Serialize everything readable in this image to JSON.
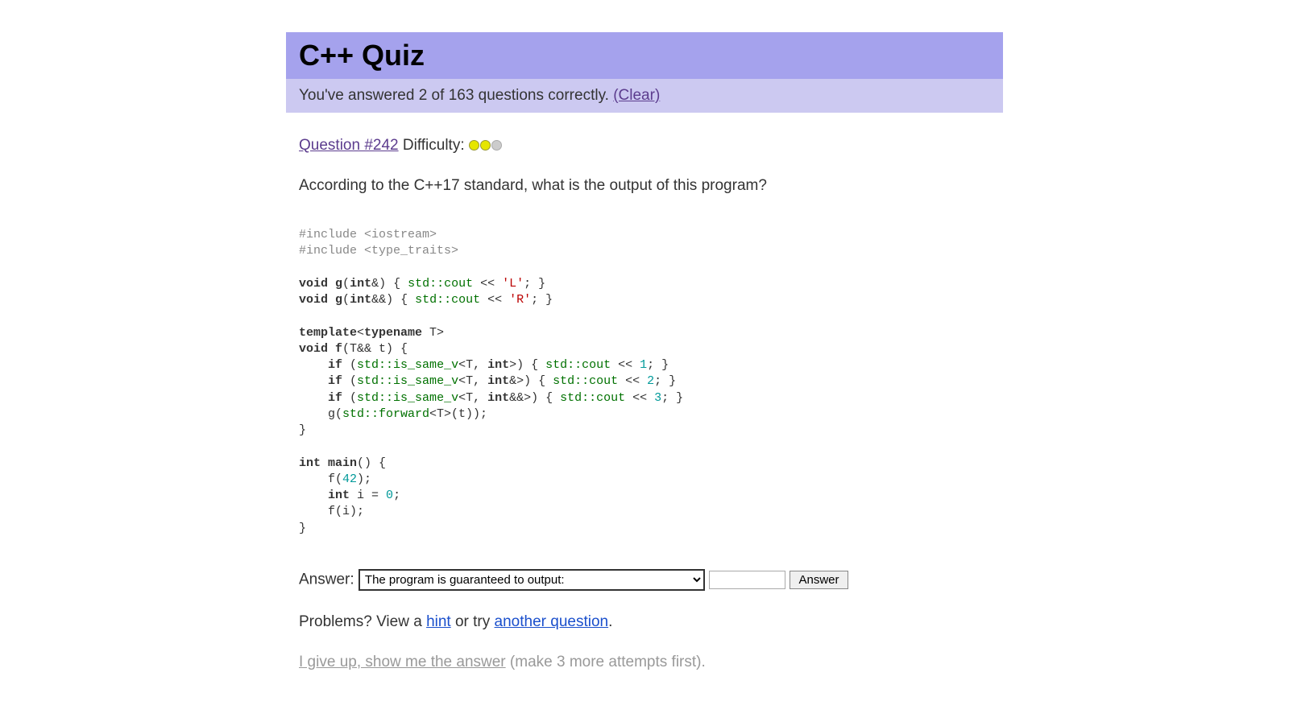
{
  "header": {
    "title": "C++ Quiz"
  },
  "progress": {
    "text_prefix": "You've answered ",
    "correct": "2",
    "text_middle": " of ",
    "total": "163",
    "text_suffix": " questions correctly. ",
    "clear_label": "(Clear)"
  },
  "question": {
    "link_label": "Question #242",
    "difficulty_label": " Difficulty: ",
    "difficulty_filled": 2,
    "difficulty_total": 3,
    "prompt": "According to the C++17 standard, what is the output of this program?"
  },
  "code": {
    "lines": [
      [
        {
          "t": "comment",
          "v": "#include <iostream>"
        }
      ],
      [
        {
          "t": "comment",
          "v": "#include <type_traits>"
        }
      ],
      [
        {
          "t": "plain",
          "v": ""
        }
      ],
      [
        {
          "t": "keyword",
          "v": "void"
        },
        {
          "t": "plain",
          "v": " "
        },
        {
          "t": "keyword",
          "v": "g"
        },
        {
          "t": "plain",
          "v": "("
        },
        {
          "t": "keyword",
          "v": "int"
        },
        {
          "t": "plain",
          "v": "&) { "
        },
        {
          "t": "stdcall",
          "v": "std::cout"
        },
        {
          "t": "plain",
          "v": " << "
        },
        {
          "t": "string",
          "v": "'L'"
        },
        {
          "t": "plain",
          "v": "; }"
        }
      ],
      [
        {
          "t": "keyword",
          "v": "void"
        },
        {
          "t": "plain",
          "v": " "
        },
        {
          "t": "keyword",
          "v": "g"
        },
        {
          "t": "plain",
          "v": "("
        },
        {
          "t": "keyword",
          "v": "int"
        },
        {
          "t": "plain",
          "v": "&&) { "
        },
        {
          "t": "stdcall",
          "v": "std::cout"
        },
        {
          "t": "plain",
          "v": " << "
        },
        {
          "t": "string",
          "v": "'R'"
        },
        {
          "t": "plain",
          "v": "; }"
        }
      ],
      [
        {
          "t": "plain",
          "v": ""
        }
      ],
      [
        {
          "t": "keyword",
          "v": "template"
        },
        {
          "t": "plain",
          "v": "<"
        },
        {
          "t": "keyword",
          "v": "typename"
        },
        {
          "t": "plain",
          "v": " T>"
        }
      ],
      [
        {
          "t": "keyword",
          "v": "void"
        },
        {
          "t": "plain",
          "v": " "
        },
        {
          "t": "keyword",
          "v": "f"
        },
        {
          "t": "plain",
          "v": "(T&& t) {"
        }
      ],
      [
        {
          "t": "plain",
          "v": "    "
        },
        {
          "t": "keyword",
          "v": "if"
        },
        {
          "t": "plain",
          "v": " ("
        },
        {
          "t": "stdcall",
          "v": "std::is_same_v"
        },
        {
          "t": "plain",
          "v": "<T, "
        },
        {
          "t": "keyword",
          "v": "int"
        },
        {
          "t": "plain",
          "v": ">) { "
        },
        {
          "t": "stdcall",
          "v": "std::cout"
        },
        {
          "t": "plain",
          "v": " << "
        },
        {
          "t": "number",
          "v": "1"
        },
        {
          "t": "plain",
          "v": "; }"
        }
      ],
      [
        {
          "t": "plain",
          "v": "    "
        },
        {
          "t": "keyword",
          "v": "if"
        },
        {
          "t": "plain",
          "v": " ("
        },
        {
          "t": "stdcall",
          "v": "std::is_same_v"
        },
        {
          "t": "plain",
          "v": "<T, "
        },
        {
          "t": "keyword",
          "v": "int"
        },
        {
          "t": "plain",
          "v": "&>) { "
        },
        {
          "t": "stdcall",
          "v": "std::cout"
        },
        {
          "t": "plain",
          "v": " << "
        },
        {
          "t": "number",
          "v": "2"
        },
        {
          "t": "plain",
          "v": "; }"
        }
      ],
      [
        {
          "t": "plain",
          "v": "    "
        },
        {
          "t": "keyword",
          "v": "if"
        },
        {
          "t": "plain",
          "v": " ("
        },
        {
          "t": "stdcall",
          "v": "std::is_same_v"
        },
        {
          "t": "plain",
          "v": "<T, "
        },
        {
          "t": "keyword",
          "v": "int"
        },
        {
          "t": "plain",
          "v": "&&>) { "
        },
        {
          "t": "stdcall",
          "v": "std::cout"
        },
        {
          "t": "plain",
          "v": " << "
        },
        {
          "t": "number",
          "v": "3"
        },
        {
          "t": "plain",
          "v": "; }"
        }
      ],
      [
        {
          "t": "plain",
          "v": "    g("
        },
        {
          "t": "stdcall",
          "v": "std::forward"
        },
        {
          "t": "plain",
          "v": "<T>(t));"
        }
      ],
      [
        {
          "t": "plain",
          "v": "}"
        }
      ],
      [
        {
          "t": "plain",
          "v": ""
        }
      ],
      [
        {
          "t": "keyword",
          "v": "int"
        },
        {
          "t": "plain",
          "v": " "
        },
        {
          "t": "keyword",
          "v": "main"
        },
        {
          "t": "plain",
          "v": "() {"
        }
      ],
      [
        {
          "t": "plain",
          "v": "    f("
        },
        {
          "t": "number",
          "v": "42"
        },
        {
          "t": "plain",
          "v": ");"
        }
      ],
      [
        {
          "t": "plain",
          "v": "    "
        },
        {
          "t": "keyword",
          "v": "int"
        },
        {
          "t": "plain",
          "v": " i = "
        },
        {
          "t": "number",
          "v": "0"
        },
        {
          "t": "plain",
          "v": ";"
        }
      ],
      [
        {
          "t": "plain",
          "v": "    f(i);"
        }
      ],
      [
        {
          "t": "plain",
          "v": "}"
        }
      ]
    ]
  },
  "answer": {
    "label": "Answer: ",
    "select_option": "The program is guaranteed to output:",
    "input_value": "",
    "submit_label": "Answer"
  },
  "problems": {
    "prefix": "Problems? View a ",
    "hint_label": "hint",
    "middle": " or try ",
    "another_label": "another question",
    "suffix": "."
  },
  "giveup": {
    "link_label": "I give up, show me the answer",
    "note": " (make 3 more attempts first)."
  }
}
